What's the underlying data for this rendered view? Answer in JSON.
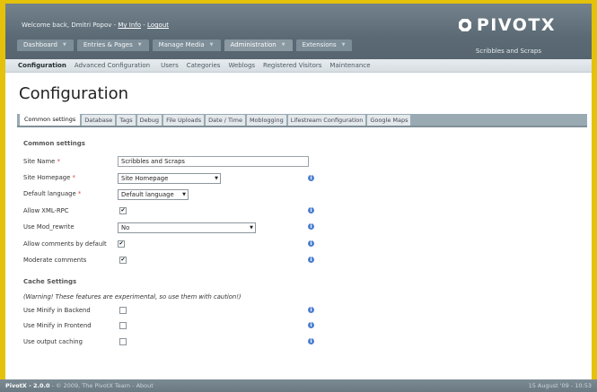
{
  "header": {
    "welcome_prefix": "Welcome back, Dmitri Popov -",
    "my_info_link": "My Info",
    "separator": "-",
    "logout_link": "Logout",
    "logo_text": "PIVOTX",
    "site_title": "Scribbles and Scraps"
  },
  "main_nav": [
    {
      "label": "Dashboard"
    },
    {
      "label": "Entries & Pages"
    },
    {
      "label": "Manage Media"
    },
    {
      "label": "Administration"
    },
    {
      "label": "Extensions"
    }
  ],
  "sub_nav": [
    {
      "label": "Configuration"
    },
    {
      "label": "Advanced Configuration"
    },
    {
      "label": "Users"
    },
    {
      "label": "Categories"
    },
    {
      "label": "Weblogs"
    },
    {
      "label": "Registered Visitors"
    },
    {
      "label": "Maintenance"
    }
  ],
  "page_title": "Configuration",
  "settings_tabs": [
    {
      "label": "Common settings"
    },
    {
      "label": "Database"
    },
    {
      "label": "Tags"
    },
    {
      "label": "Debug"
    },
    {
      "label": "File Uploads"
    },
    {
      "label": "Date / Time"
    },
    {
      "label": "Moblogging"
    },
    {
      "label": "Lifestream Configuration"
    },
    {
      "label": "Google Maps"
    }
  ],
  "form": {
    "common_heading": "Common settings",
    "required_mark": "*",
    "site_name": {
      "label": "Site Name",
      "value": "Scribbles and Scraps"
    },
    "site_homepage": {
      "label": "Site Homepage",
      "value": "Site Homepage"
    },
    "default_language": {
      "label": "Default language",
      "value": "Default language"
    },
    "allow_xmlrpc": {
      "label": "Allow XML-RPC",
      "checked": true
    },
    "use_mod_rewrite": {
      "label": "Use Mod_rewrite",
      "value": "No"
    },
    "allow_comments": {
      "label": "Allow comments by default",
      "checked": true
    },
    "moderate_comments": {
      "label": "Moderate comments",
      "checked": true
    },
    "cache_heading": "Cache Settings",
    "cache_warning": "(Warning! These features are experimental, so use them with caution!)",
    "minify_backend": {
      "label": "Use Minify in Backend",
      "checked": false
    },
    "minify_frontend": {
      "label": "Use Minify in Frontend",
      "checked": false
    },
    "output_caching": {
      "label": "Use output caching",
      "checked": false
    },
    "check_glyph": "✔",
    "info_glyph": "i",
    "dropdown_glyph": "▼"
  },
  "footer": {
    "version": "PivotX - 2.0.0",
    "credit": "- © 2009, The PivotX Team - About",
    "timestamp": "15 August '09 - 10:53"
  },
  "colors": {
    "border_yellow": "#e4c10a",
    "header_bg": "#5e6d77",
    "info_blue": "#4c7fd0",
    "required_red": "#d9443d"
  }
}
